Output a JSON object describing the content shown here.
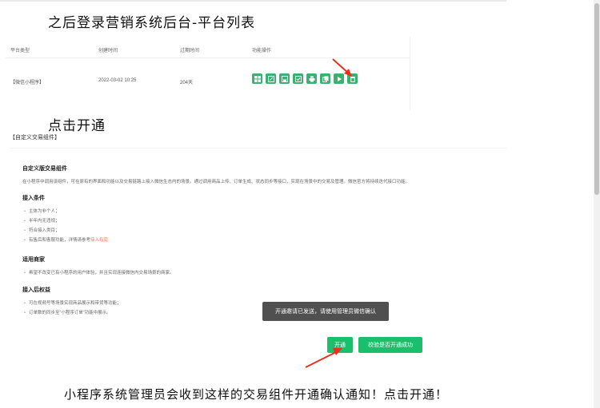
{
  "headings": {
    "top": "之后登录营销系统后台-平台列表",
    "click": "点击开通",
    "bottom": "小程序系统管理员会收到这样的交易组件开通确认通知！点击开通！"
  },
  "table": {
    "headers": [
      "平台类型",
      "创建时间",
      "过期时间",
      "功能操作"
    ],
    "row": {
      "type": "【微信小程序】",
      "created": "2022-03-02 10:25",
      "expire": "204天"
    },
    "op_icons": [
      "grid-icon",
      "edit-icon",
      "save-icon",
      "check-edit-icon",
      "print-icon",
      "copy-icon",
      "play-icon",
      "trash-icon"
    ]
  },
  "component_label": "【自定义交易组件】",
  "panel": {
    "title": "自定义版交易组件",
    "desc": "在小程序中调用该组件，可在原有的界面和功能以及交易链路上接入微信生态内的场景。通过调用商品上传、订单生成、状态同步等接口，实现在场景中的交易及管理。微信官方将持续迭代接口功能。",
    "cond_title": "接入条件",
    "conds": [
      "主体为非个人；",
      "半年内无违规；",
      "符合接入类目；"
    ],
    "cond_last": "有售后和客服功能，详情请参考",
    "cond_link": "接入指南",
    "merchant_title": "适用商家",
    "merchant": "希望不改变已有小程序的用户体验，并且实现连接微信内交易场景的商家。",
    "rights_title": "接入后权益",
    "rights": [
      "可在视频号等场景实现商品展示和带货等功能；",
      "订单数的同步至“小程序订单”功能中展示。"
    ]
  },
  "toast": "开通邀请已发送，请使用管理员微信确认",
  "buttons": {
    "open": "开通",
    "check": "校验是否开通成功"
  },
  "colors": {
    "green": "#3bb070",
    "button": "#1bbf6b",
    "arrow": "#e8321e"
  }
}
